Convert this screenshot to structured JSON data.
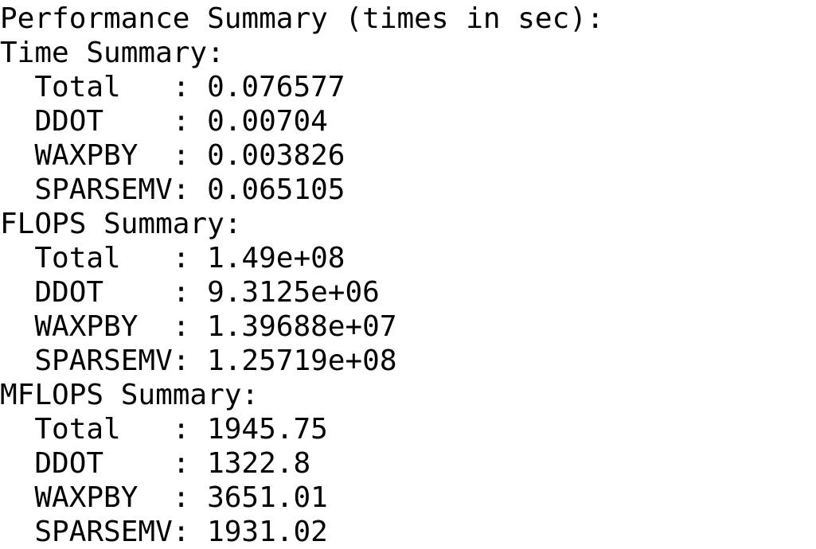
{
  "terminal": {
    "lines": [
      "Performance Summary (times in sec):",
      "Time Summary:",
      "  Total   : 0.076577",
      "  DDOT    : 0.00704",
      "  WAXPBY  : 0.003826",
      "  SPARSEMV: 0.065105",
      "FLOPS Summary:",
      "  Total   : 1.49e+08",
      "  DDOT    : 9.3125e+06",
      "  WAXPBY  : 1.39688e+07",
      "  SPARSEMV: 1.25719e+08",
      "MFLOPS Summary:",
      "  Total   : 1945.75",
      "  DDOT    : 1322.8",
      "  WAXPBY  : 3651.01",
      "  SPARSEMV: 1931.02"
    ]
  },
  "colors": {
    "background": "#ffffff",
    "text": "#000000"
  }
}
